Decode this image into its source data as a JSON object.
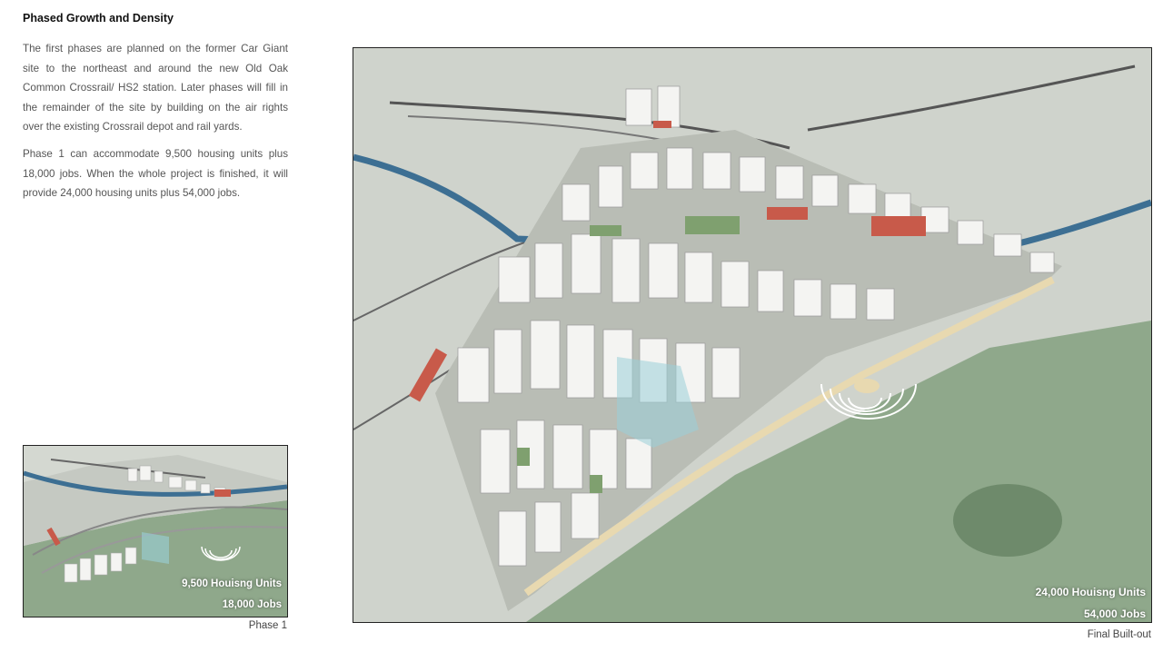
{
  "header": {
    "title": "Phased Growth and Density"
  },
  "body": {
    "paragraph_1": "The first phases are planned on the former Car Giant site to the northeast and around the new Old Oak Common Crossrail/ HS2 station. Later phases will fill in the remainder of the site by building on the air rights over the existing Crossrail depot and rail yards.",
    "paragraph_2": "Phase 1 can accommodate 9,500 housing units plus 18,000 jobs.  When the whole project is finished, it will provide 24,000 housing units plus 54,000 jobs."
  },
  "phase1_figure": {
    "units_label": "9,500 Houisng Units",
    "jobs_label": "18,000 Jobs",
    "caption": "Phase 1"
  },
  "final_figure": {
    "units_label": "24,000 Houisng Units",
    "jobs_label": "54,000 Jobs",
    "caption": "Final Built-out"
  },
  "colors": {
    "park_green": "#8fa88b",
    "urban_grey": "#c9cdc5",
    "canal_blue": "#3d6f93",
    "building_white": "#f4f4f2",
    "accent_red": "#c85a4a"
  }
}
